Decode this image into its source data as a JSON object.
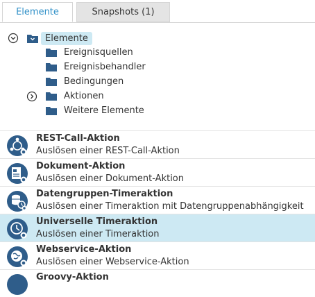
{
  "tabs": [
    {
      "label": "Elemente"
    },
    {
      "label": "Snapshots (1)"
    }
  ],
  "tree": {
    "root_label": "Elemente",
    "children": [
      {
        "label": "Ereignisquellen"
      },
      {
        "label": "Ereignisbehandler"
      },
      {
        "label": "Bedingungen"
      },
      {
        "label": "Aktionen"
      },
      {
        "label": "Weitere Elemente"
      }
    ]
  },
  "actions": [
    {
      "title": "REST-Call-Aktion",
      "subtitle": "Auslösen einer REST-Call-Aktion",
      "icon": "rest-call-icon"
    },
    {
      "title": "Dokument-Aktion",
      "subtitle": "Auslösen einer Dokument-Aktion",
      "icon": "document-icon"
    },
    {
      "title": "Datengruppen-Timeraktion",
      "subtitle": "Auslösen einer Timeraktion mit Datengruppenabhängigkeit",
      "icon": "datagroup-timer-icon"
    },
    {
      "title": "Universelle Timeraktion",
      "subtitle": "Auslösen einer Timeraktion",
      "icon": "timer-icon",
      "selected": true
    },
    {
      "title": "Webservice-Aktion",
      "subtitle": "Auslösen einer Webservice-Aktion",
      "icon": "webservice-icon"
    },
    {
      "title": "Groovy-Aktion",
      "subtitle": "",
      "icon": "groovy-icon"
    }
  ],
  "colors": {
    "accent": "#2e8fc7",
    "selection": "#cde9f3",
    "icon_dark": "#2f5d8a",
    "folder": "#2f5d8a"
  }
}
